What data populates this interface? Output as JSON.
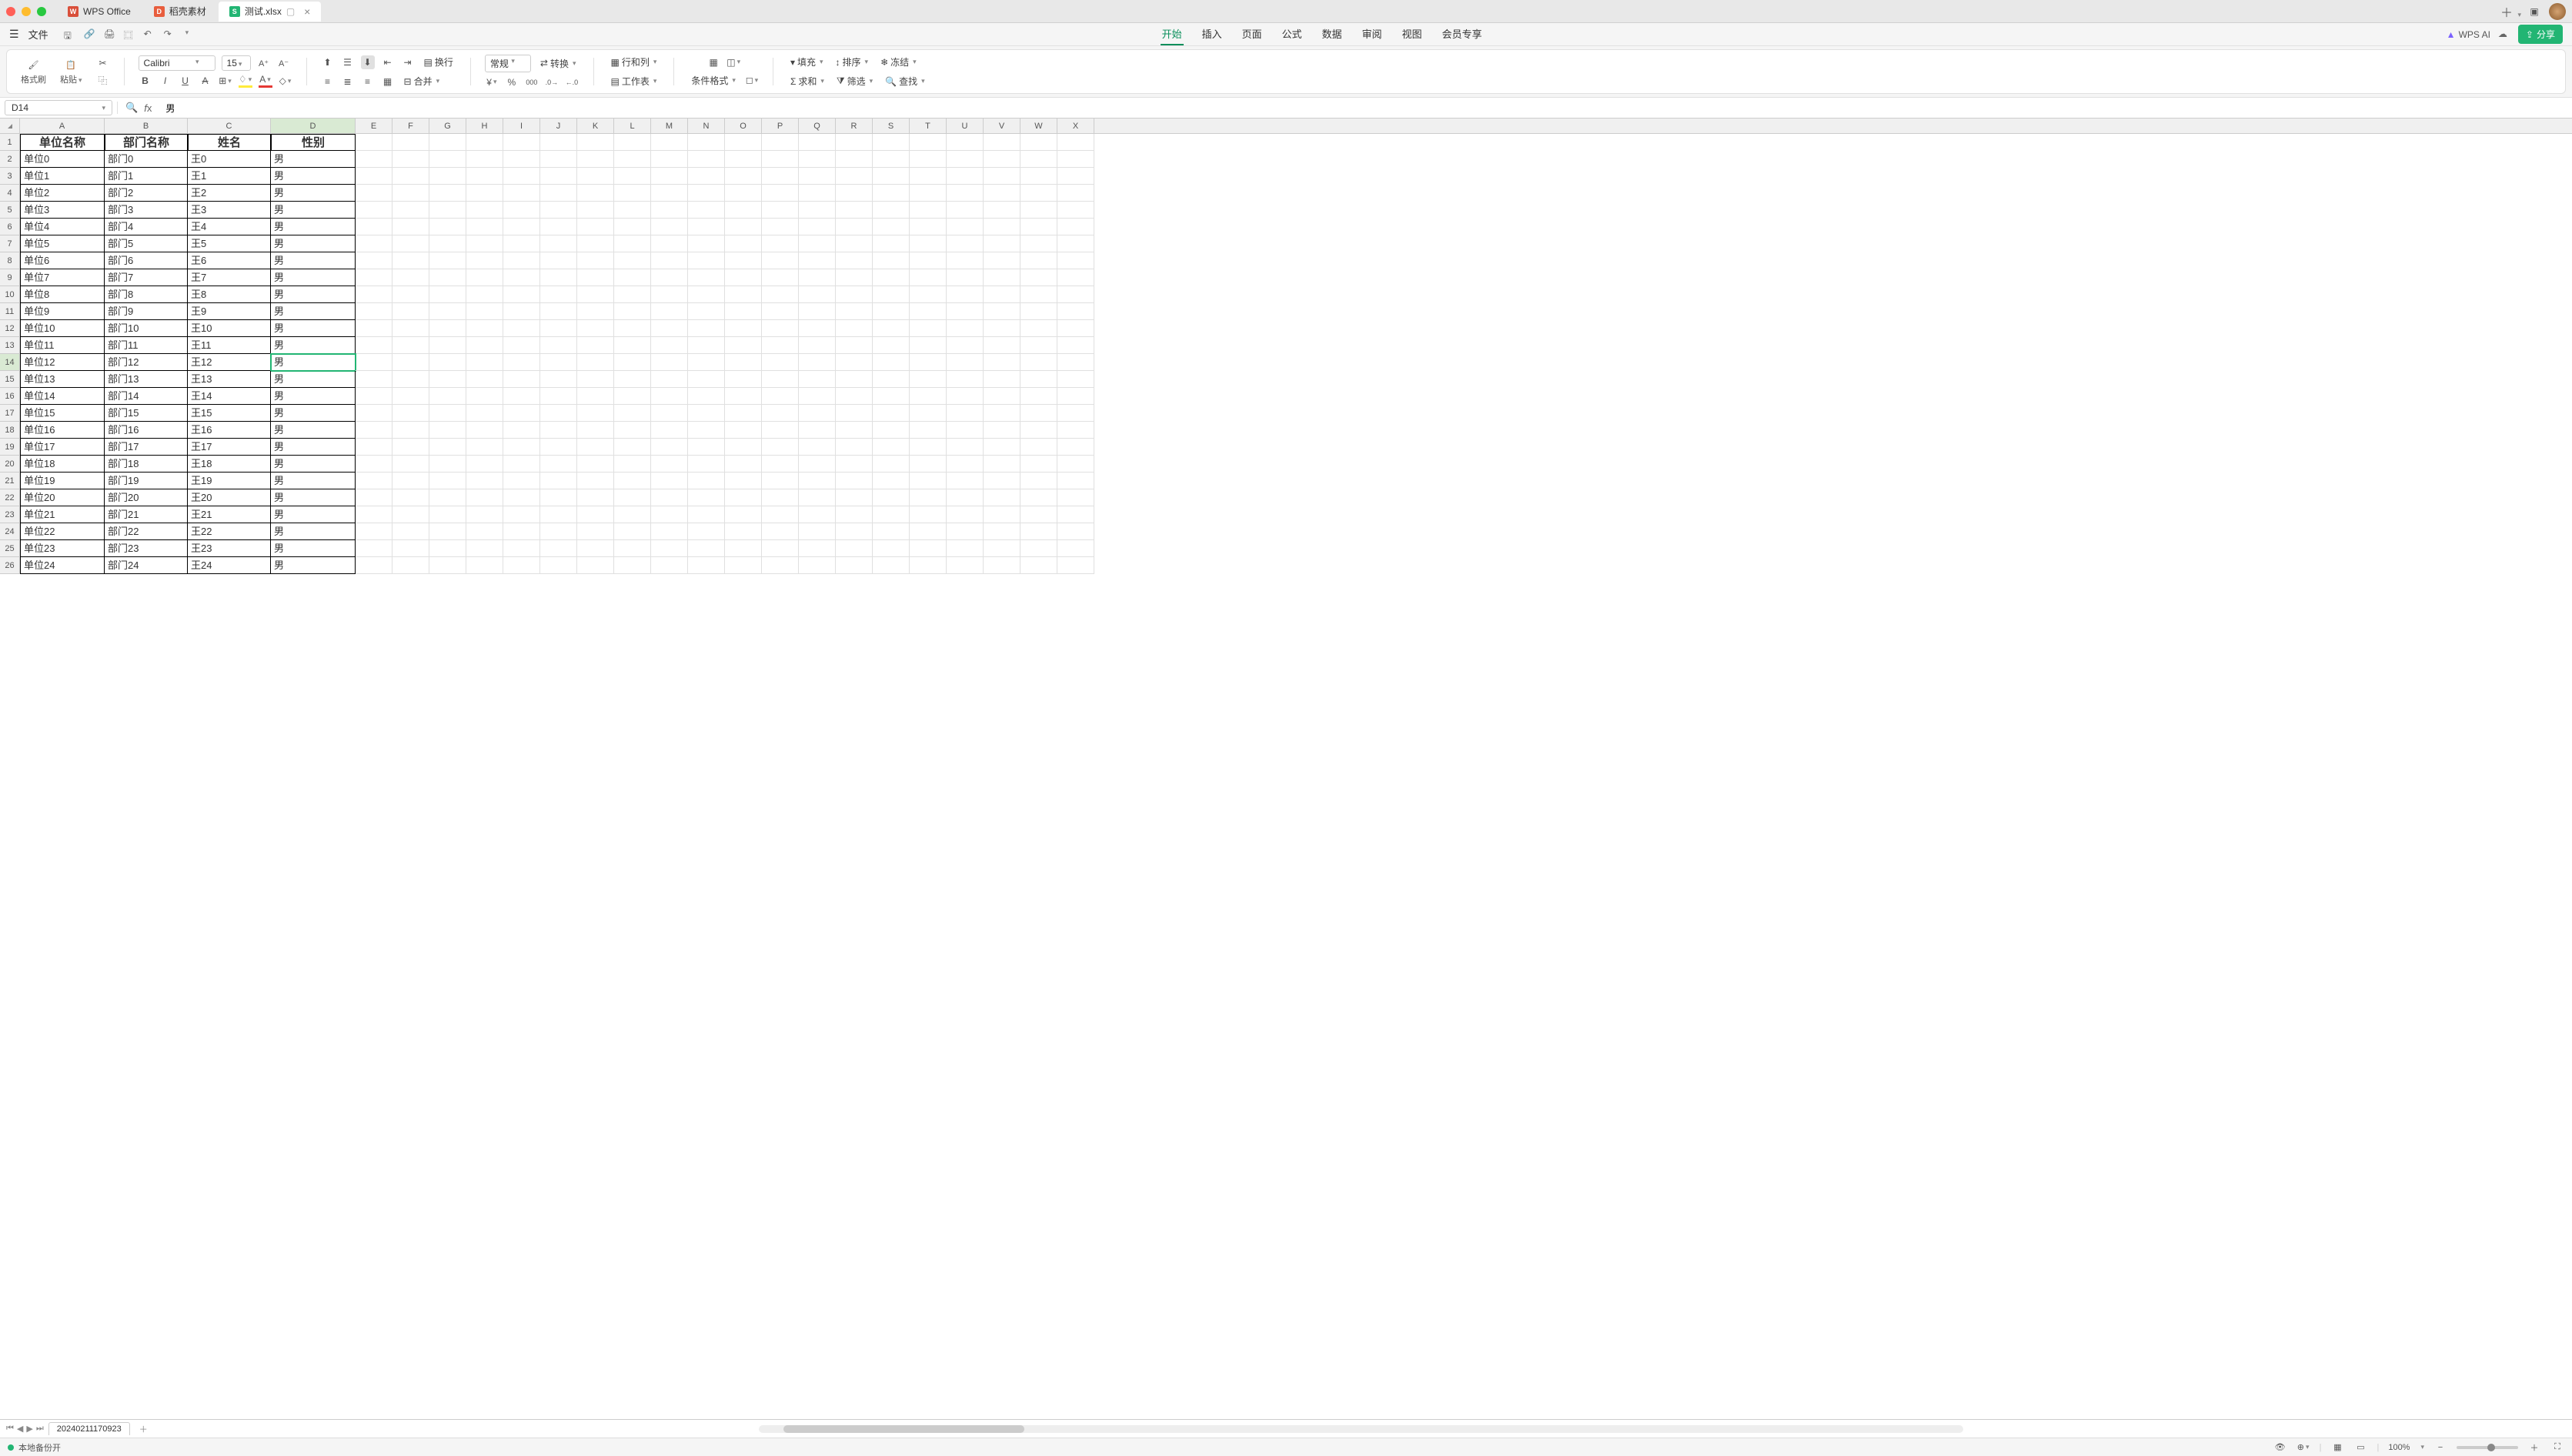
{
  "window": {
    "tabs": [
      {
        "icon_bg": "#d94f3a",
        "icon_text": "W",
        "label": "WPS Office"
      },
      {
        "icon_bg": "#e85d3d",
        "icon_text": "D",
        "label": "稻壳素材"
      },
      {
        "icon_bg": "#22b573",
        "icon_text": "S",
        "label": "测试.xlsx",
        "active": true,
        "closeable": true
      }
    ]
  },
  "menubar": {
    "file": "文件",
    "items": [
      "开始",
      "插入",
      "页面",
      "公式",
      "数据",
      "审阅",
      "视图",
      "会员专享"
    ],
    "active": "开始",
    "wps_ai": "WPS AI",
    "share": "分享"
  },
  "ribbon": {
    "format_painter": "格式刷",
    "paste": "粘贴",
    "font_name": "Calibri",
    "font_size": "15",
    "number_format": "常规",
    "wrap": "换行",
    "merge": "合并",
    "convert": "转换",
    "row_col": "行和列",
    "worksheet": "工作表",
    "cond_fmt": "条件格式",
    "fill": "填充",
    "sort": "排序",
    "sum": "求和",
    "filter": "筛选",
    "freeze": "冻结",
    "find": "查找"
  },
  "formula_bar": {
    "cell_ref": "D14",
    "formula": "男"
  },
  "grid": {
    "columns": [
      "A",
      "B",
      "C",
      "D",
      "E",
      "F",
      "G",
      "H",
      "I",
      "J",
      "K",
      "L",
      "M",
      "N",
      "O",
      "P",
      "Q",
      "R",
      "S",
      "T",
      "U",
      "V",
      "W",
      "X"
    ],
    "selected_col": "D",
    "selected_row": 14,
    "headers": [
      "单位名称",
      "部门名称",
      "姓名",
      "性别"
    ],
    "rows": [
      [
        "单位0",
        "部门0",
        "王0",
        "男"
      ],
      [
        "单位1",
        "部门1",
        "王1",
        "男"
      ],
      [
        "单位2",
        "部门2",
        "王2",
        "男"
      ],
      [
        "单位3",
        "部门3",
        "王3",
        "男"
      ],
      [
        "单位4",
        "部门4",
        "王4",
        "男"
      ],
      [
        "单位5",
        "部门5",
        "王5",
        "男"
      ],
      [
        "单位6",
        "部门6",
        "王6",
        "男"
      ],
      [
        "单位7",
        "部门7",
        "王7",
        "男"
      ],
      [
        "单位8",
        "部门8",
        "王8",
        "男"
      ],
      [
        "单位9",
        "部门9",
        "王9",
        "男"
      ],
      [
        "单位10",
        "部门10",
        "王10",
        "男"
      ],
      [
        "单位11",
        "部门11",
        "王11",
        "男"
      ],
      [
        "单位12",
        "部门12",
        "王12",
        "男"
      ],
      [
        "单位13",
        "部门13",
        "王13",
        "男"
      ],
      [
        "单位14",
        "部门14",
        "王14",
        "男"
      ],
      [
        "单位15",
        "部门15",
        "王15",
        "男"
      ],
      [
        "单位16",
        "部门16",
        "王16",
        "男"
      ],
      [
        "单位17",
        "部门17",
        "王17",
        "男"
      ],
      [
        "单位18",
        "部门18",
        "王18",
        "男"
      ],
      [
        "单位19",
        "部门19",
        "王19",
        "男"
      ],
      [
        "单位20",
        "部门20",
        "王20",
        "男"
      ],
      [
        "单位21",
        "部门21",
        "王21",
        "男"
      ],
      [
        "单位22",
        "部门22",
        "王22",
        "男"
      ],
      [
        "单位23",
        "部门23",
        "王23",
        "男"
      ],
      [
        "单位24",
        "部门24",
        "王24",
        "男"
      ]
    ]
  },
  "sheets": {
    "active": "20240211170923"
  },
  "statusbar": {
    "status": "本地备份开",
    "zoom": "100%"
  }
}
